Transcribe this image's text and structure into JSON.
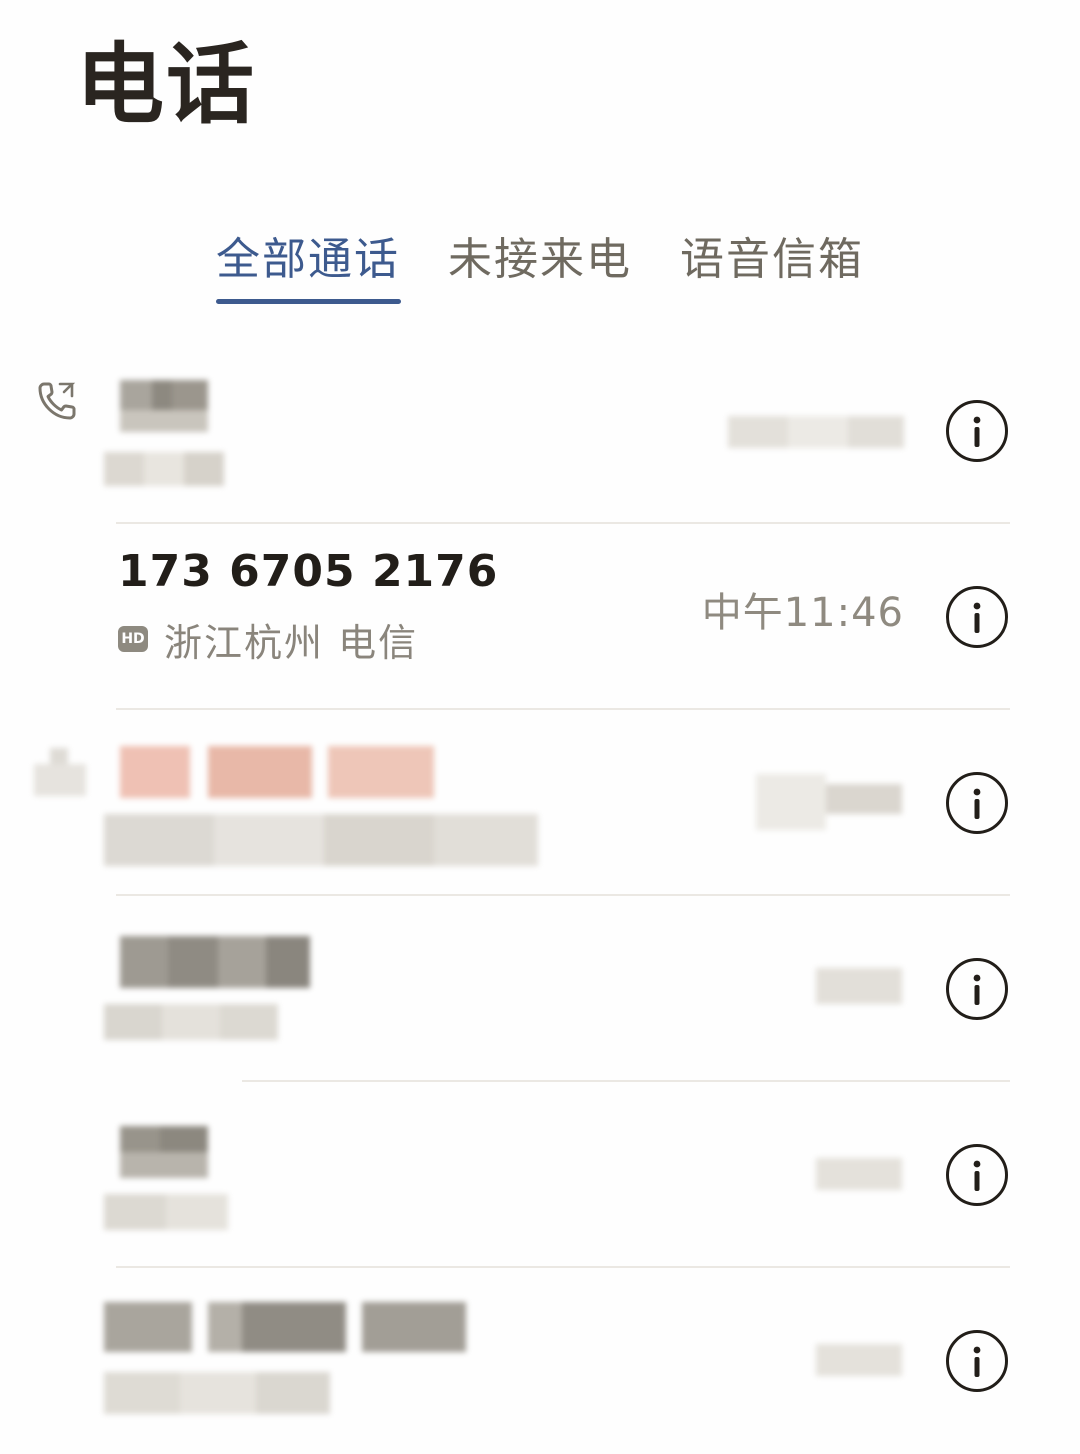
{
  "header": {
    "title": "电话"
  },
  "tabs": [
    {
      "label": "全部通话",
      "active": true
    },
    {
      "label": "未接来电",
      "active": false
    },
    {
      "label": "语音信箱",
      "active": false
    }
  ],
  "colors": {
    "accent": "#3d5a8e",
    "text_primary": "#221e19",
    "text_secondary": "#8a857c",
    "divider": "#ebe8e3",
    "badge": "#8e8a80"
  },
  "calls": [
    {
      "name": "",
      "number": "",
      "location": "",
      "time": "",
      "type_icon": "outgoing-call-icon",
      "obscured": true
    },
    {
      "name": "173 6705 2176",
      "badge": "HD",
      "location": "浙江杭州 电信",
      "time": "中午11:46",
      "obscured": false
    },
    {
      "name": "",
      "location": "",
      "time": "",
      "type_icon": "missed-call-icon",
      "obscured": true
    },
    {
      "name": "",
      "location": "",
      "time": "",
      "obscured": true
    },
    {
      "name": "",
      "location": "",
      "time": "",
      "obscured": true
    },
    {
      "name": "",
      "location": "",
      "time": "",
      "obscured": true
    }
  ]
}
